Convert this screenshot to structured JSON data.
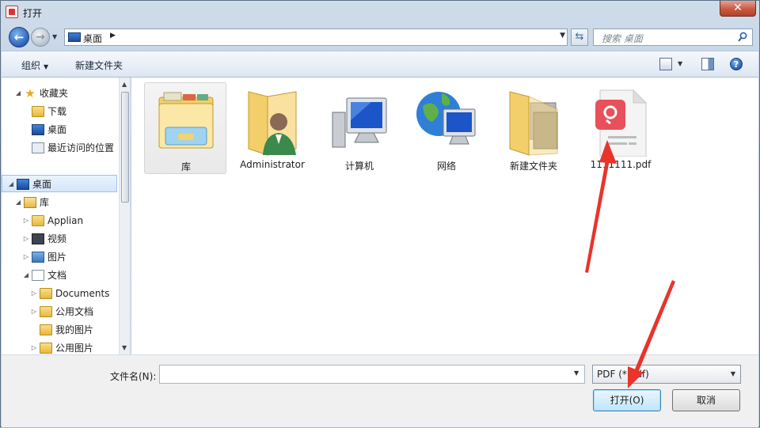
{
  "window": {
    "title": "打开",
    "close_label": "✕"
  },
  "nav": {
    "address": "桌面",
    "search_placeholder": "搜索 桌面"
  },
  "toolbar": {
    "organize": "组织",
    "new_folder": "新建文件夹",
    "help": "?"
  },
  "tree": {
    "favorites": "收藏夹",
    "downloads": "下载",
    "desktop_fav": "桌面",
    "recent": "最近访问的位置",
    "desktop": "桌面",
    "libraries": "库",
    "applian": "Applian",
    "videos": "视频",
    "pictures": "图片",
    "documents": "文档",
    "my_documents": "Documents",
    "public_documents": "公用文档",
    "my_pictures": "我的图片",
    "public_pictures": "公用图片"
  },
  "files": [
    {
      "name": "库",
      "icon": "library-icon"
    },
    {
      "name": "Administrator",
      "icon": "user-folder-icon"
    },
    {
      "name": "计算机",
      "icon": "computer-icon"
    },
    {
      "name": "网络",
      "icon": "network-icon"
    },
    {
      "name": "新建文件夹",
      "icon": "folder-icon"
    },
    {
      "name": "1111111.pdf",
      "icon": "pdf-icon"
    }
  ],
  "bottom": {
    "filename_label": "文件名(N):",
    "filename_value": "",
    "filetype": "PDF (*.pdf)",
    "open": "打开(O)",
    "cancel": "取消"
  },
  "colors": {
    "accent": "#2a62b8",
    "arrow": "#e8342b",
    "pdf": "#e8505b"
  }
}
